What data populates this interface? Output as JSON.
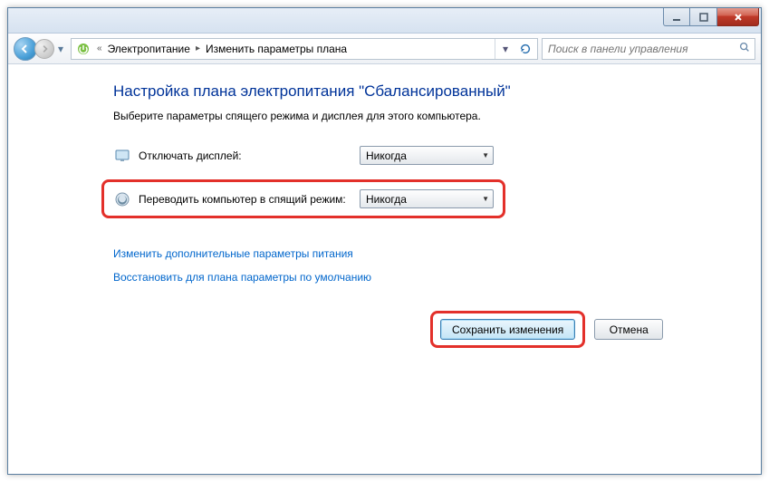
{
  "breadcrumb": {
    "root": "Электропитание",
    "current": "Изменить параметры плана"
  },
  "search": {
    "placeholder": "Поиск в панели управления"
  },
  "page": {
    "title": "Настройка плана электропитания \"Сбалансированный\"",
    "subhead": "Выберите параметры спящего режима и дисплея для этого компьютера."
  },
  "settings": {
    "display_off_label": "Отключать дисплей:",
    "display_off_value": "Никогда",
    "sleep_label": "Переводить компьютер в спящий режим:",
    "sleep_value": "Никогда"
  },
  "links": {
    "advanced": "Изменить дополнительные параметры питания",
    "restore": "Восстановить для плана параметры по умолчанию"
  },
  "buttons": {
    "save": "Сохранить изменения",
    "cancel": "Отмена"
  }
}
